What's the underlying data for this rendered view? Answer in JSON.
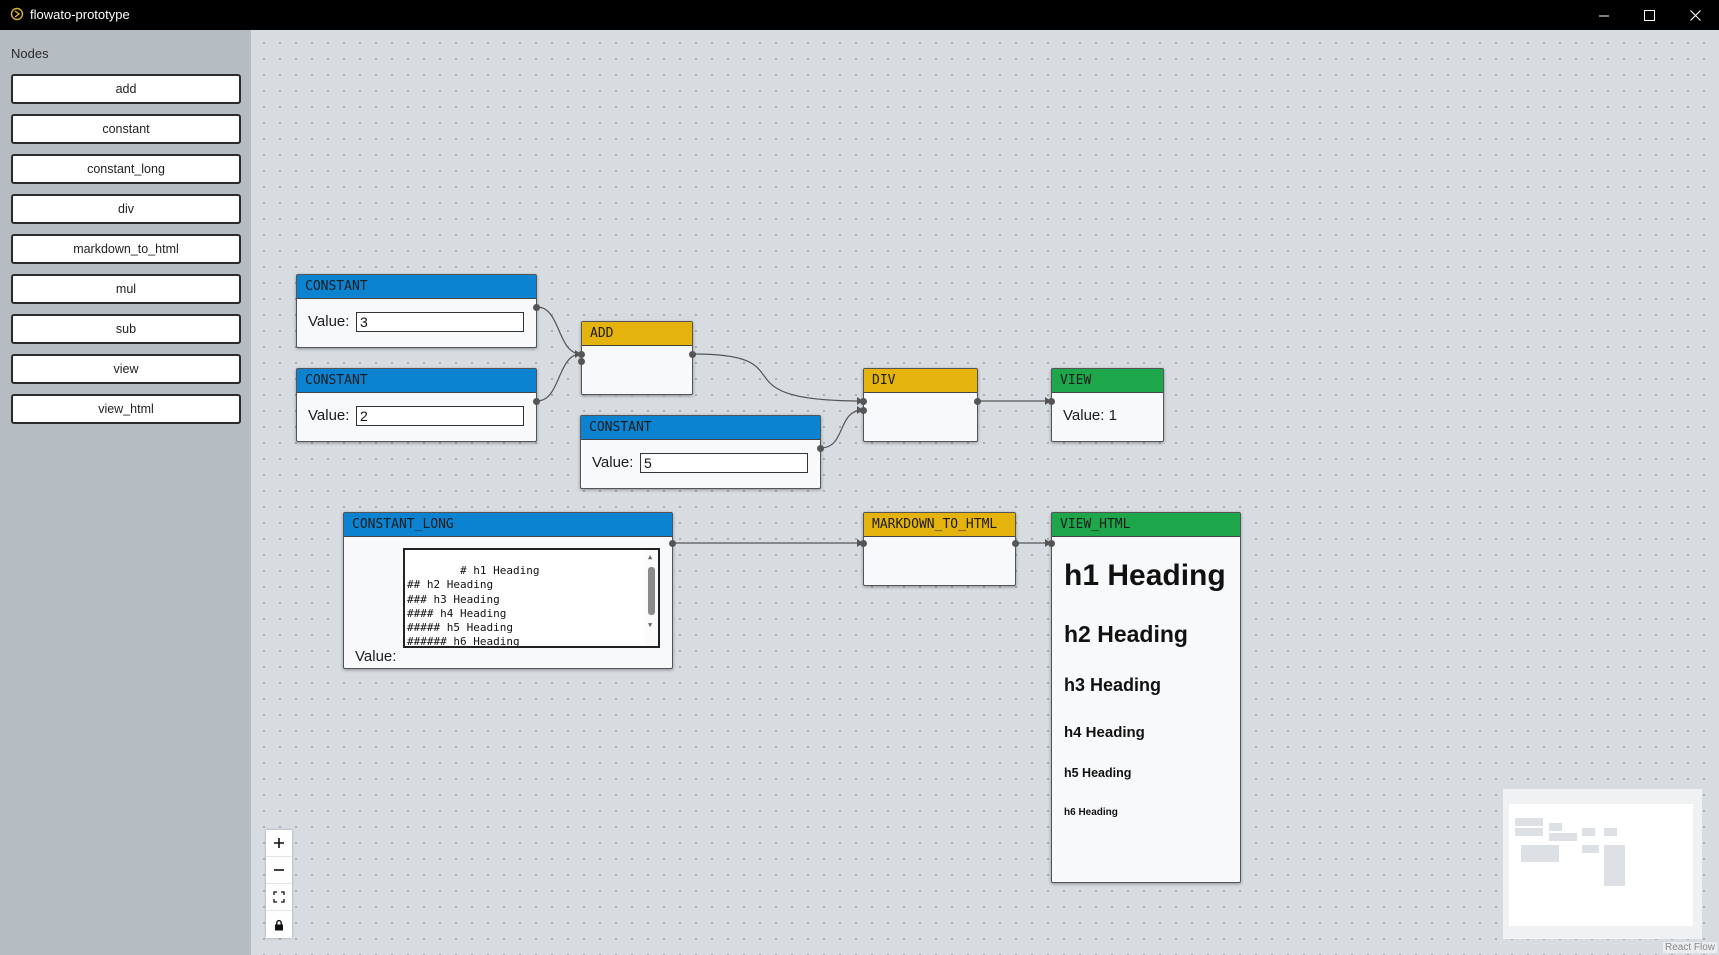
{
  "window": {
    "title": "flowato-prototype",
    "app_icon": "flow-icon",
    "controls": [
      "minimize-icon",
      "maximize-icon",
      "close-icon"
    ]
  },
  "sidebar": {
    "heading": "Nodes",
    "items": [
      {
        "label": "add"
      },
      {
        "label": "constant"
      },
      {
        "label": "constant_long"
      },
      {
        "label": "div"
      },
      {
        "label": "markdown_to_html"
      },
      {
        "label": "mul"
      },
      {
        "label": "sub"
      },
      {
        "label": "view"
      },
      {
        "label": "view_html"
      }
    ]
  },
  "nodes": {
    "constant_a": {
      "title": "CONSTANT",
      "value_label": "Value:",
      "value": "3"
    },
    "constant_b": {
      "title": "CONSTANT",
      "value_label": "Value:",
      "value": "2"
    },
    "add": {
      "title": "ADD"
    },
    "constant_c": {
      "title": "CONSTANT",
      "value_label": "Value:",
      "value": "5"
    },
    "div": {
      "title": "DIV"
    },
    "view": {
      "title": "VIEW",
      "value_text": "Value: 1"
    },
    "constant_long": {
      "title": "CONSTANT_LONG",
      "value_label": "Value:",
      "value": "# h1 Heading\n## h2 Heading\n### h3 Heading\n#### h4 Heading\n##### h5 Heading\n###### h6 Heading\n"
    },
    "markdown_to_html": {
      "title": "MARKDOWN_TO_HTML"
    },
    "view_html": {
      "title": "VIEW_HTML",
      "headings": {
        "h1": "h1 Heading",
        "h2": "h2 Heading",
        "h3": "h3 Heading",
        "h4": "h4 Heading",
        "h5": "h5 Heading",
        "h6": "h6 Heading"
      }
    }
  },
  "controls": {
    "buttons": [
      "zoom-in-icon",
      "zoom-out-icon",
      "fit-view-icon",
      "lock-icon"
    ]
  },
  "attribution": "React Flow",
  "colors": {
    "constant_header": "#0b83d0",
    "operator_header": "#e4b30e",
    "view_header": "#1ea64b",
    "sidebar_bg": "#b5bcc2",
    "canvas_bg": "#d7dce1"
  }
}
